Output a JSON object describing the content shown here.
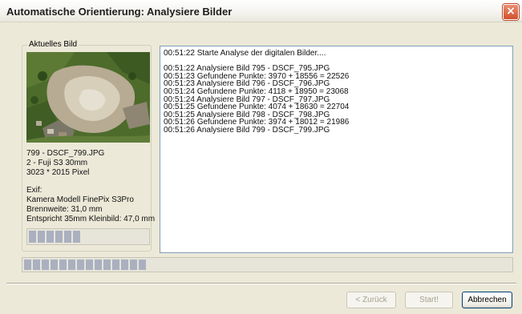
{
  "window": {
    "title": "Automatische Orientierung: Analysiere Bilder",
    "close_glyph": "×"
  },
  "current_image": {
    "group_label": "Aktuelles Bild",
    "filename_line": "799 - DSCF_799.JPG",
    "camera_line": "2 - Fuji S3  30mm",
    "size_line": "3023 * 2015 Pixel",
    "exif_label": "Exif:",
    "exif_model": "Kamera Modell FinePix S3Pro",
    "exif_focal": "Brennweite: 31,0 mm",
    "exif_35mm": "Entspricht 35mm Kleinbild: 47,0 mm"
  },
  "image_progress": {
    "segments_filled": 6,
    "fraction": 0.42
  },
  "total_progress": {
    "segments_filled": 14,
    "fraction": 0.29
  },
  "log": {
    "lines": [
      "00:51:22  Starte Analyse der digitalen Bilder....",
      "",
      "00:51:22  Analysiere Bild 795 - DSCF_795.JPG",
      "00:51:23  Gefundene Punkte: 3970 + 18556  =  22526",
      "00:51:23  Analysiere Bild 796 - DSCF_796.JPG",
      "00:51:24  Gefundene Punkte: 4118 + 18950  =  23068",
      "00:51:24  Analysiere Bild 797 - DSCF_797.JPG",
      "00:51:25  Gefundene Punkte: 4074 + 18630  =  22704",
      "00:51:25  Analysiere Bild 798 - DSCF_798.JPG",
      "00:51:26  Gefundene Punkte: 3974 + 18012  =  21986",
      "00:51:26  Analysiere Bild 799 - DSCF_799.JPG"
    ]
  },
  "buttons": {
    "back": "< Zurück",
    "start": "Start!",
    "cancel": "Abbrechen"
  },
  "colors": {
    "dialog_bg": "#ece9d8",
    "progress_segment": "#aab0bf",
    "close_button": "#d1502c"
  },
  "icons": {
    "close": "close-icon"
  }
}
